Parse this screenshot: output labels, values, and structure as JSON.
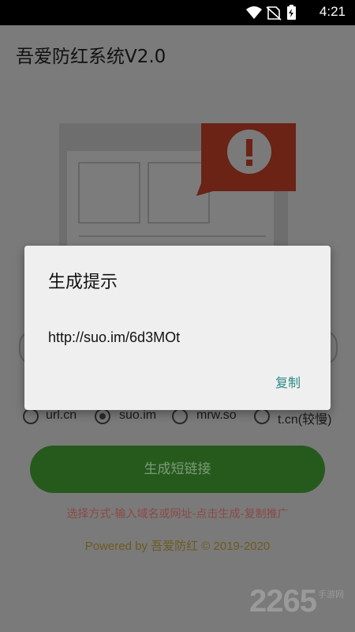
{
  "status_bar": {
    "time": "4:21",
    "icons": [
      "wifi-icon",
      "no-sim-icon",
      "battery-charging-icon"
    ]
  },
  "app_bar": {
    "title": "吾爱防红系统V2.0"
  },
  "options": [
    {
      "label": "url.cn",
      "checked": false
    },
    {
      "label": "suo.im",
      "checked": true
    },
    {
      "label": "mrw.so",
      "checked": false
    },
    {
      "label": "t.cn(较慢)",
      "checked": false
    }
  ],
  "generate_button": {
    "label": "生成短链接"
  },
  "hint": "选择方式-输入域名或网址-点击生成-复制推广",
  "footer": "Powered by 吾爱防红 © 2019-2020",
  "watermark": {
    "number": "2265",
    "text": "手游网"
  },
  "dialog": {
    "title": "生成提示",
    "message": "http://suo.im/6d3MOt",
    "copy_button": "复制"
  },
  "colors": {
    "accent": "#2b8a86",
    "button": "#255a1c",
    "alert": "#b52a18"
  }
}
